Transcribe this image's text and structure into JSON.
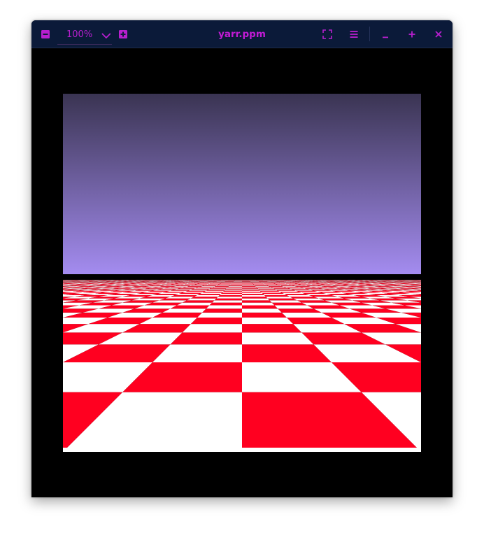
{
  "window": {
    "title": "yarr.ppm"
  },
  "toolbar": {
    "zoom_out": "zoom-out-icon",
    "zoom_level": "100%",
    "zoom_dropdown": "chevron-down-icon",
    "zoom_in": "zoom-in-icon",
    "fullscreen": "fullscreen-icon",
    "menu": "hamburger-menu-icon"
  },
  "window_controls": {
    "minimize": "minimize-icon",
    "maximize": "maximize-icon",
    "close": "close-icon"
  },
  "image": {
    "sky_top": "#3a3452",
    "sky_bottom": "#a48cf0",
    "checker_red": "#ff0020",
    "checker_white": "#ffffff"
  },
  "colors": {
    "header_bg": "#0b1a39",
    "accent": "#c21bd6",
    "window_bg": "#000000"
  }
}
